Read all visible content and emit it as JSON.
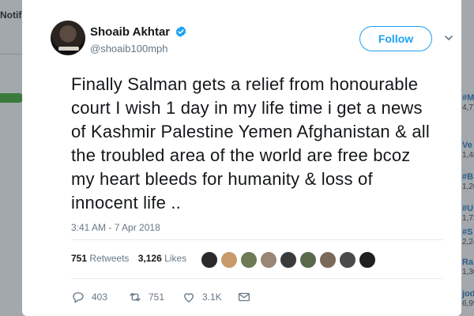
{
  "background": {
    "left_nav_text": "Notif",
    "trends": [
      {
        "tag": "#M",
        "count": "4,77"
      },
      {
        "tag": "Ve",
        "count": "1,48"
      },
      {
        "tag": "#B",
        "count": "1,20"
      },
      {
        "tag": "#U",
        "count": "1,73"
      },
      {
        "tag": "#S",
        "count": "2,24"
      },
      {
        "tag": "Ra",
        "count": "1,30"
      },
      {
        "tag": "jod",
        "count": "6,99"
      }
    ]
  },
  "tweet": {
    "author_name": "Shoaib Akhtar",
    "author_handle": "@shoaib100mph",
    "follow_label": "Follow",
    "text": "Finally Salman gets a relief from honourable court I wish 1 day in my life time i get a news of Kashmir Palestine Yemen Afghanistan & all the troubled area of the world are free bcoz my heart bleeds for humanity & loss of innocent life ..",
    "timestamp": "3:41 AM - 7 Apr 2018",
    "retweets_count": "751",
    "retweets_label": "Retweets",
    "likes_count": "3,126",
    "likes_label": "Likes",
    "liker_colors": [
      "#2b2b2b",
      "#c89a6a",
      "#6d7a55",
      "#9b8574",
      "#3a3a3a",
      "#5a6a4a",
      "#7a6a5a",
      "#4a4a4a",
      "#1f1f1f"
    ],
    "reply_count": "403",
    "retweet_action_count": "751",
    "like_action_count": "3.1K",
    "accent_color": "#1da1f2"
  }
}
